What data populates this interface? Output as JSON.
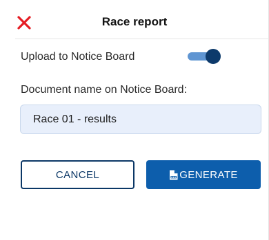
{
  "dialog": {
    "title": "Race report",
    "close_icon": "close-icon"
  },
  "upload": {
    "label": "Upload to Notice Board",
    "toggle_on": true
  },
  "document_name": {
    "label": "Document name on Notice Board:",
    "value": "Race 01 - results"
  },
  "actions": {
    "cancel_label": "CANCEL",
    "generate_label": "GENERATE",
    "generate_icon": "pdf-file-icon"
  },
  "colors": {
    "close": "#e51c23",
    "toggle_track": "#5f95d2",
    "toggle_thumb": "#0d3a6b",
    "input_bg": "#e8effb",
    "cancel_border": "#0b3766",
    "generate_bg": "#0d5eac"
  }
}
